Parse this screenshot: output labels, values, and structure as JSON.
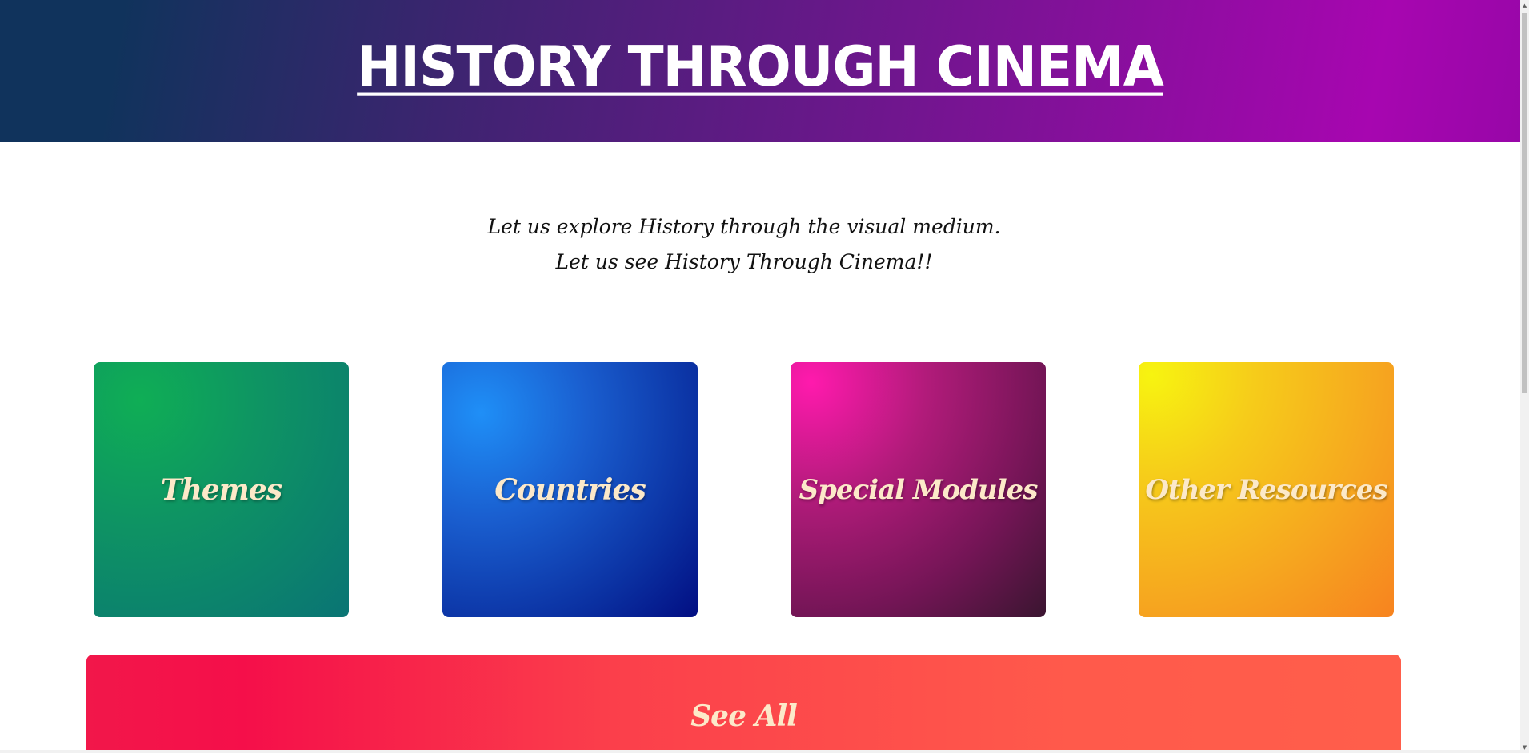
{
  "header": {
    "title": "HISTORY THROUGH CINEMA"
  },
  "intro": {
    "line1": "Let us explore History through the visual medium.",
    "line2": "Let us see History Through Cinema!!"
  },
  "cards": [
    {
      "label": "Themes",
      "color": "#0e9463"
    },
    {
      "label": "Countries",
      "color": "#1a5fd0"
    },
    {
      "label": "Special Modules",
      "color": "#b11b7a"
    },
    {
      "label": "Other Resources",
      "color": "#f6cc1a"
    }
  ],
  "see_all": {
    "label": "See All",
    "color": "#f50f4a"
  },
  "colors": {
    "header_start": "#10335c",
    "header_end": "#a706b0",
    "label_text": "#fce9c9"
  },
  "scrollbar": {
    "up_icon": "scroll-up-arrow",
    "down_icon": "scroll-down-arrow"
  }
}
